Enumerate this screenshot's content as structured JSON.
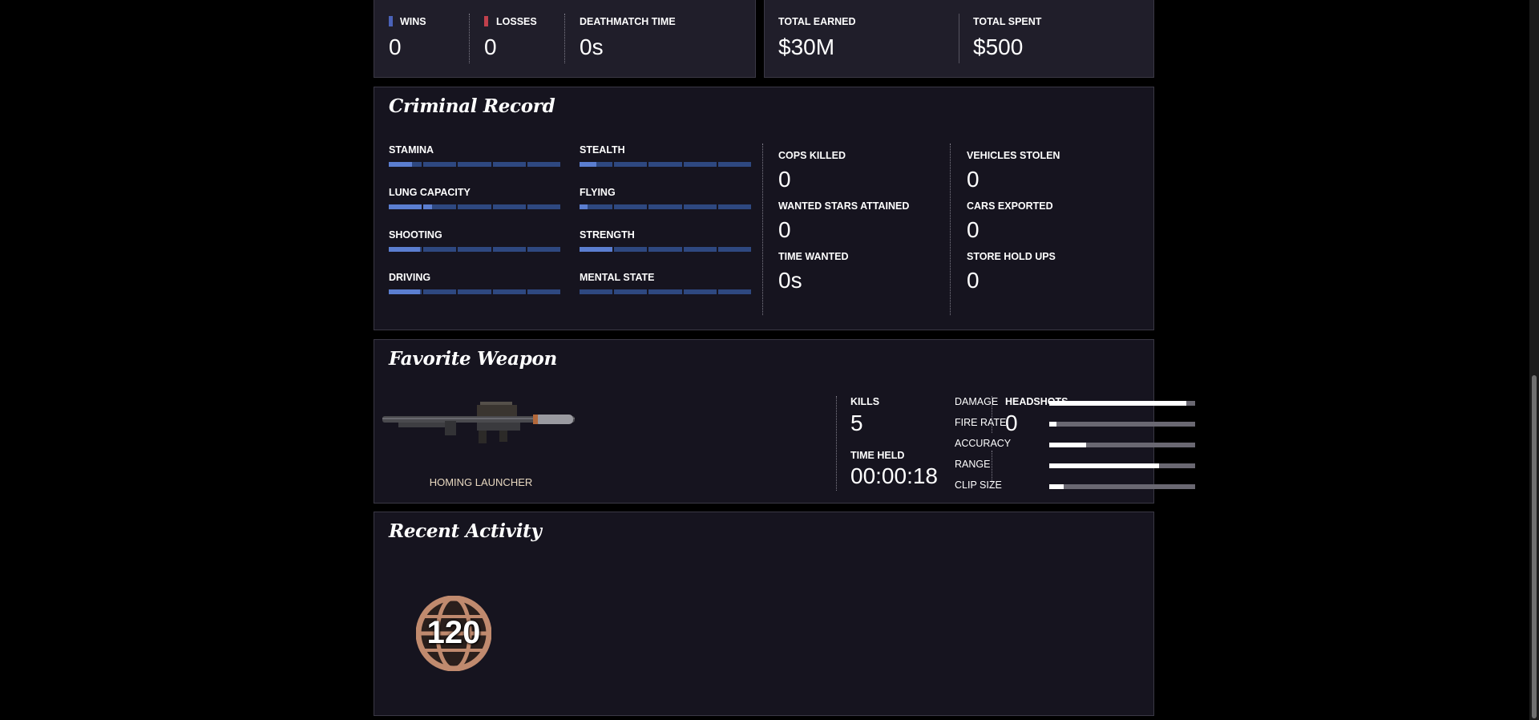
{
  "deathmatch": {
    "wins_label": "WINS",
    "wins_value": "0",
    "losses_label": "LOSSES",
    "losses_value": "0",
    "time_label": "DEATHMATCH TIME",
    "time_value": "0s"
  },
  "money": {
    "earned_label": "TOTAL EARNED",
    "earned_value": "$30M",
    "spent_label": "TOTAL SPENT",
    "spent_value": "$500"
  },
  "criminal_record": {
    "title": "Criminal Record",
    "skills": [
      {
        "label": "STAMINA",
        "level": 0.14
      },
      {
        "label": "STEALTH",
        "level": 0.1
      },
      {
        "label": "LUNG CAPACITY",
        "level": 0.25
      },
      {
        "label": "FLYING",
        "level": 0.05
      },
      {
        "label": "SHOOTING",
        "level": 0.19
      },
      {
        "label": "STRENGTH",
        "level": 0.2
      },
      {
        "label": "DRIVING",
        "level": 0.19
      },
      {
        "label": "MENTAL STATE",
        "level": 0.0
      }
    ],
    "stats": {
      "cops_killed_label": "COPS KILLED",
      "cops_killed_value": "0",
      "wanted_stars_label": "WANTED STARS ATTAINED",
      "wanted_stars_value": "0",
      "time_wanted_label": "TIME WANTED",
      "time_wanted_value": "0s",
      "vehicles_stolen_label": "VEHICLES STOLEN",
      "vehicles_stolen_value": "0",
      "cars_exported_label": "CARS EXPORTED",
      "cars_exported_value": "0",
      "store_holdups_label": "STORE HOLD UPS",
      "store_holdups_value": "0"
    }
  },
  "favorite_weapon": {
    "title": "Favorite Weapon",
    "name": "HOMING LAUNCHER",
    "stats": [
      {
        "label": "DAMAGE",
        "level": 0.94
      },
      {
        "label": "FIRE RATE",
        "level": 0.05
      },
      {
        "label": "ACCURACY",
        "level": 0.25
      },
      {
        "label": "RANGE",
        "level": 0.75
      },
      {
        "label": "CLIP SIZE",
        "level": 0.1
      }
    ],
    "kills_label": "KILLS",
    "kills_value": "5",
    "headshots_label": "HEADSHOTS",
    "headshots_value": "0",
    "time_held_label": "TIME HELD",
    "time_held_value": "00:00:18"
  },
  "recent_activity": {
    "title": "Recent Activity",
    "badge_number": "120"
  },
  "colors": {
    "wins_marker": "#4a62b8",
    "losses_marker": "#c0404c",
    "skill_fill": "#5b7ed0",
    "skill_track": "#2e4880",
    "badge": "#c08a6e"
  }
}
